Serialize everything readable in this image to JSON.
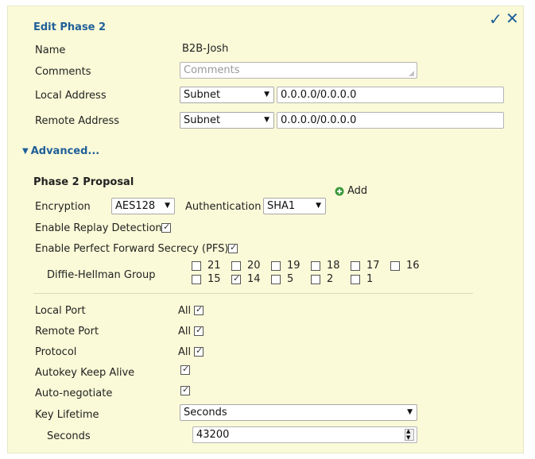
{
  "header": {
    "title": "Edit Phase 2",
    "save_icon": "checkmark-icon",
    "close_icon": "close-icon"
  },
  "name": {
    "label": "Name",
    "value": "B2B-Josh"
  },
  "comments": {
    "label": "Comments",
    "placeholder": "Comments"
  },
  "local_address": {
    "label": "Local Address",
    "type": "Subnet",
    "value": "0.0.0.0/0.0.0.0"
  },
  "remote_address": {
    "label": "Remote Address",
    "type": "Subnet",
    "value": "0.0.0.0/0.0.0.0"
  },
  "advanced": {
    "label": "Advanced..."
  },
  "proposal": {
    "title": "Phase 2 Proposal",
    "add_label": "Add",
    "encryption_label": "Encryption",
    "encryption_value": "AES128",
    "authentication_label": "Authentication",
    "authentication_value": "SHA1"
  },
  "replay": {
    "label": "Enable Replay Detection",
    "checked": true
  },
  "pfs": {
    "label": "Enable Perfect Forward Secrecy (PFS)",
    "checked": true
  },
  "dh": {
    "label": "Diffie-Hellman Group",
    "groups": [
      {
        "value": "21",
        "checked": false
      },
      {
        "value": "20",
        "checked": false
      },
      {
        "value": "19",
        "checked": false
      },
      {
        "value": "18",
        "checked": false
      },
      {
        "value": "17",
        "checked": false
      },
      {
        "value": "16",
        "checked": false
      },
      {
        "value": "15",
        "checked": false
      },
      {
        "value": "14",
        "checked": true
      },
      {
        "value": "5",
        "checked": false
      },
      {
        "value": "2",
        "checked": false
      },
      {
        "value": "1",
        "checked": false
      }
    ]
  },
  "local_port": {
    "label": "Local Port",
    "all_label": "All",
    "checked": true
  },
  "remote_port": {
    "label": "Remote Port",
    "all_label": "All",
    "checked": true
  },
  "protocol": {
    "label": "Protocol",
    "all_label": "All",
    "checked": true
  },
  "keepalive": {
    "label": "Autokey Keep Alive",
    "checked": true
  },
  "autoneg": {
    "label": "Auto-negotiate",
    "checked": true
  },
  "key_lifetime": {
    "label": "Key Lifetime",
    "value": "Seconds"
  },
  "seconds": {
    "label": "Seconds",
    "value": "43200"
  },
  "colors": {
    "accent": "#1f5f99",
    "panel_bg": "#fafad8",
    "add_icon_green": "#3c9a3c"
  }
}
